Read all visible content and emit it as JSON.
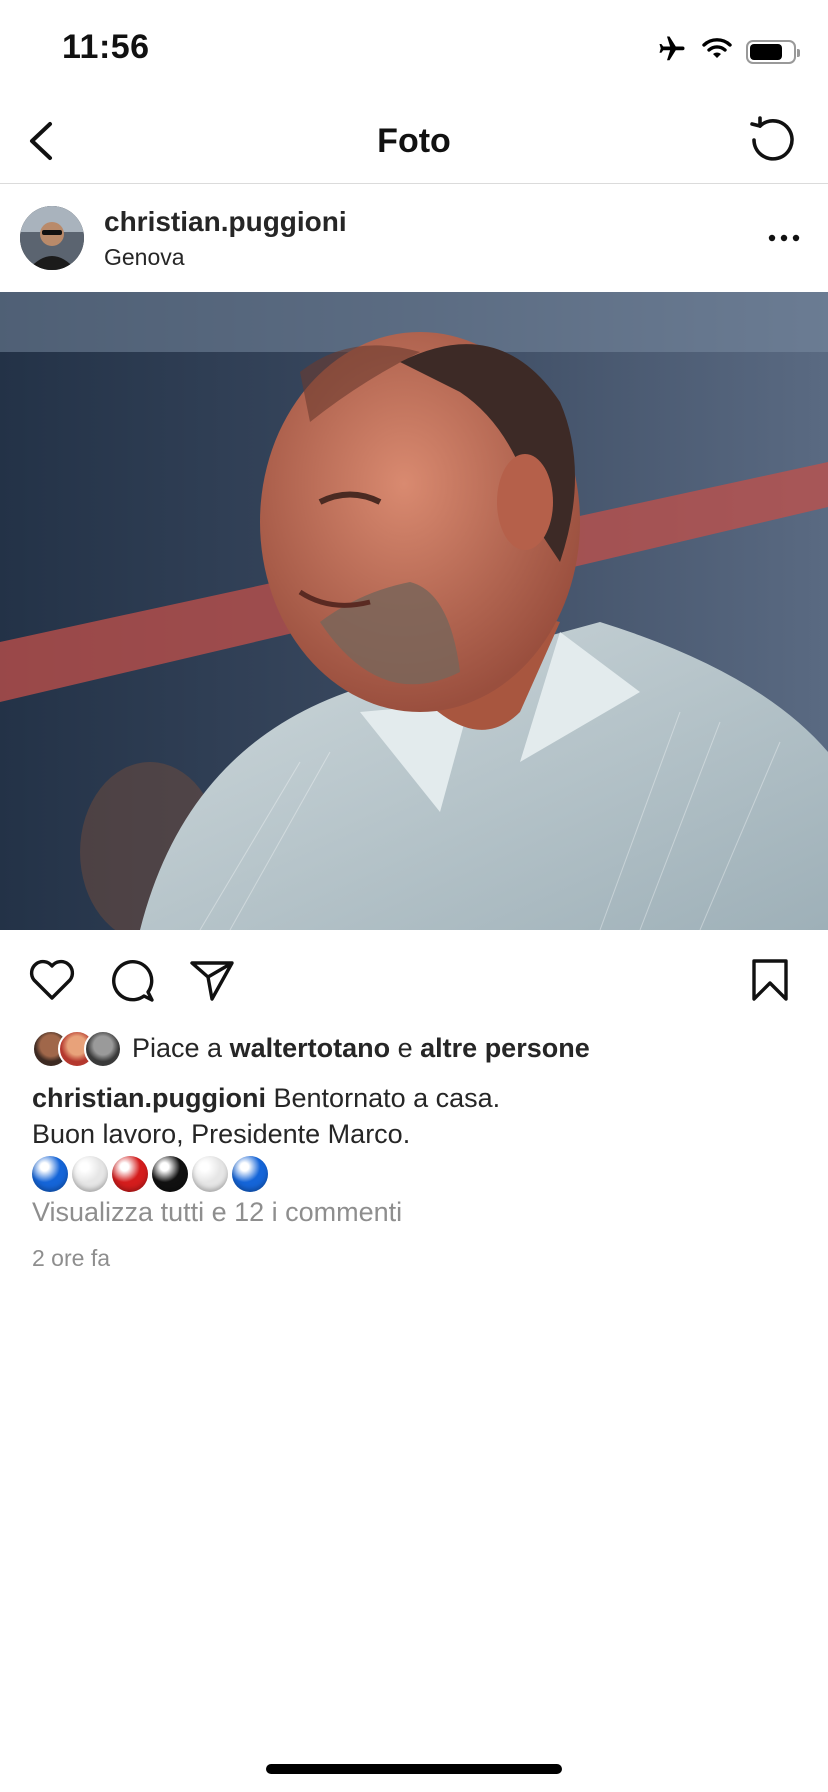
{
  "status_bar": {
    "time": "11:56"
  },
  "nav": {
    "title": "Foto"
  },
  "post": {
    "username": "christian.puggioni",
    "location": "Genova",
    "likes_prefix": "Piace a",
    "likes_user": "waltertotano",
    "likes_conj": "e",
    "likes_others": "altre persone",
    "caption_user": "christian.puggioni",
    "caption_line1": "Bentornato a casa.",
    "caption_line2": "Buon lavoro, Presidente Marco.",
    "emoji_balls": [
      "blue",
      "white",
      "red",
      "black",
      "white",
      "blue"
    ],
    "comments_link": "Visualizza tutti e 12 i commenti",
    "time_ago": "2 ore fa"
  },
  "colors": {
    "blue": "#1565d8",
    "white": "#e6e6e6",
    "red": "#d41d1d",
    "black": "#111111"
  },
  "icons": [
    "airplane-icon",
    "wifi-icon",
    "battery-icon",
    "chevron-left-icon",
    "refresh-icon",
    "more-icon",
    "heart-icon",
    "comment-icon",
    "share-icon",
    "bookmark-icon"
  ]
}
